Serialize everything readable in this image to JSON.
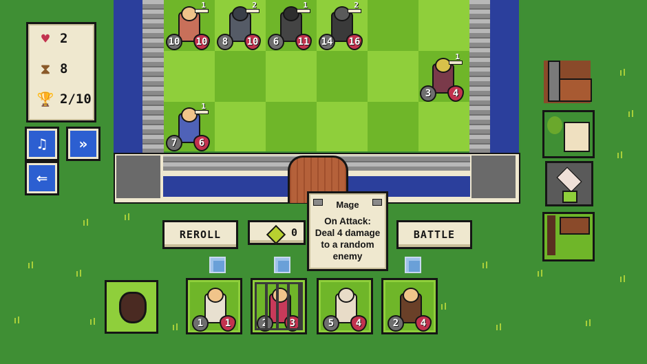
{
  "stats": {
    "lives": "2",
    "turn": "8",
    "trophies": "2/10"
  },
  "side_buttons": {
    "music_glyph": "♫",
    "fast_forward_glyph": "»",
    "exit_glyph": "⇐"
  },
  "enemy_units": [
    {
      "level": "1",
      "attack": "10",
      "health": "10",
      "color": "#c8705a"
    },
    {
      "level": "2",
      "attack": "8",
      "health": "10",
      "color": "#555b66"
    },
    {
      "level": "1",
      "attack": "6",
      "health": "11",
      "color": "#444444"
    },
    {
      "level": "2",
      "attack": "14",
      "health": "16",
      "color": "#3a3a3a"
    },
    {
      "level": "1",
      "attack": "3",
      "health": "4",
      "color": "#d8c04a"
    }
  ],
  "player_board_unit": {
    "level": "1",
    "attack": "7",
    "health": "6",
    "color": "#4f62b8"
  },
  "controls": {
    "reroll_label": "REROLL",
    "gold_value": "0",
    "battle_label": "BATTLE"
  },
  "tooltip": {
    "title": "Mage",
    "text_lines": [
      "On Attack:",
      "Deal 4 damage",
      "to a random",
      "enemy"
    ]
  },
  "shop_units": [
    {
      "attack": "1",
      "health": "1",
      "color": "#e8e0d0",
      "frozen": false
    },
    {
      "attack": "2",
      "health": "3",
      "color": "#c83a5a",
      "frozen": true
    },
    {
      "attack": "5",
      "health": "4",
      "color": "#e8dcc8",
      "frozen": false
    },
    {
      "attack": "2",
      "health": "4",
      "color": "#6a4028",
      "frozen": false
    }
  ],
  "colors": {
    "grass": "#3f8f34",
    "panel": "#efe8cf",
    "outline": "#151515",
    "moat": "#2b3f9c",
    "tile_light": "#8fcf3b",
    "tile_dark": "#6fb629",
    "button_blue": "#2c5fd1",
    "health_red": "#c2334f"
  }
}
